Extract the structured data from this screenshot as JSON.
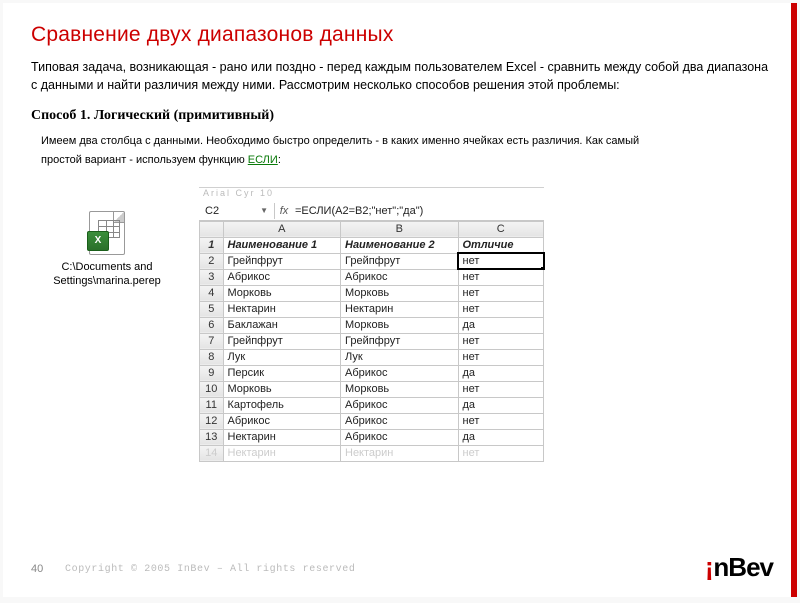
{
  "title": "Сравнение двух диапазонов данных",
  "intro": "Типовая задача, возникающая - рано или поздно - перед каждым пользователем Excel - сравнить между собой два диапазона с данными и найти различия между ними. Рассмотрим несколько способов решения этой проблемы:",
  "method_head": "Способ 1. Логический (примитивный)",
  "desc_line1": "Имеем два столбца с данными. Необходимо быстро определить - в каких именно ячейках есть различия. Как самый",
  "desc_line2_a": "простой вариант - используем функцию ",
  "desc_fn": "ЕСЛИ",
  "desc_line2_b": ":",
  "file_path": "C:\\Documents and Settings\\marina.perep",
  "excel": {
    "toolbar_hint": "Arial Cyr       10",
    "cell_ref": "C2",
    "formula": "=ЕСЛИ(A2=B2;\"нет\";\"да\")",
    "col_labels": [
      "A",
      "B",
      "C"
    ],
    "headers": {
      "a": "Наименование 1",
      "b": "Наименование 2",
      "c": "Отличие"
    },
    "rows": [
      {
        "n": "2",
        "a": "Грейпфрут",
        "b": "Грейпфрут",
        "c": "нет"
      },
      {
        "n": "3",
        "a": "Абрикос",
        "b": "Абрикос",
        "c": "нет"
      },
      {
        "n": "4",
        "a": "Морковь",
        "b": "Морковь",
        "c": "нет"
      },
      {
        "n": "5",
        "a": "Нектарин",
        "b": "Нектарин",
        "c": "нет"
      },
      {
        "n": "6",
        "a": "Баклажан",
        "b": "Морковь",
        "c": "да"
      },
      {
        "n": "7",
        "a": "Грейпфрут",
        "b": "Грейпфрут",
        "c": "нет"
      },
      {
        "n": "8",
        "a": "Лук",
        "b": "Лук",
        "c": "нет"
      },
      {
        "n": "9",
        "a": "Персик",
        "b": "Абрикос",
        "c": "да"
      },
      {
        "n": "10",
        "a": "Морковь",
        "b": "Морковь",
        "c": "нет"
      },
      {
        "n": "11",
        "a": "Картофель",
        "b": "Абрикос",
        "c": "да"
      },
      {
        "n": "12",
        "a": "Абрикос",
        "b": "Абрикос",
        "c": "нет"
      },
      {
        "n": "13",
        "a": "Нектарин",
        "b": "Абрикос",
        "c": "да"
      }
    ],
    "faded_row": {
      "n": "14",
      "a": "Нектарин",
      "b": "Нектарин",
      "c": "нет"
    }
  },
  "footer": {
    "page": "40",
    "copyright": "Copyright © 2005 InBev – All rights reserved",
    "logo_rest": "nBev"
  }
}
